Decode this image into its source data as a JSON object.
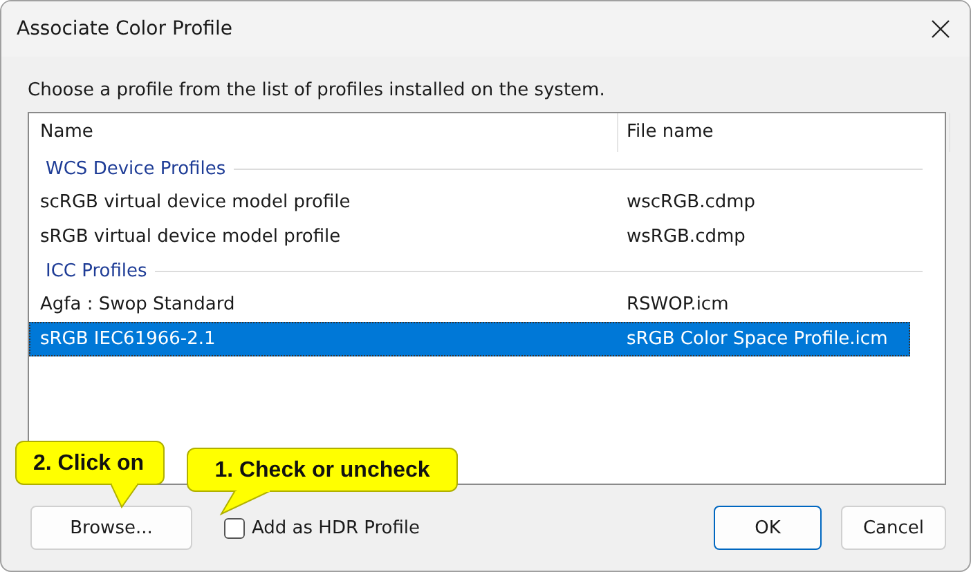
{
  "window": {
    "title": "Associate Color Profile"
  },
  "instruction": "Choose a profile from the list of profiles installed on the system.",
  "table": {
    "columns": [
      "Name",
      "File name"
    ],
    "rows": [
      {
        "kind": "group",
        "name": "WCS Device Profiles"
      },
      {
        "kind": "profile",
        "name": "scRGB virtual device model profile",
        "file": "wscRGB.cdmp",
        "selected": false
      },
      {
        "kind": "profile",
        "name": "sRGB virtual device model profile",
        "file": "wsRGB.cdmp",
        "selected": false
      },
      {
        "kind": "group",
        "name": "ICC Profiles"
      },
      {
        "kind": "profile",
        "name": "Agfa : Swop Standard",
        "file": "RSWOP.icm",
        "selected": false
      },
      {
        "kind": "profile",
        "name": "sRGB IEC61966-2.1",
        "file": "sRGB Color Space Profile.icm",
        "selected": true
      }
    ]
  },
  "browse_button": "Browse...",
  "hdr_checkbox": {
    "label": "Add as HDR Profile",
    "checked": false
  },
  "buttons": [
    "OK",
    "Cancel"
  ],
  "callouts": [
    {
      "text": "2. Click on"
    },
    {
      "text": "1. Check or uncheck"
    }
  ]
}
